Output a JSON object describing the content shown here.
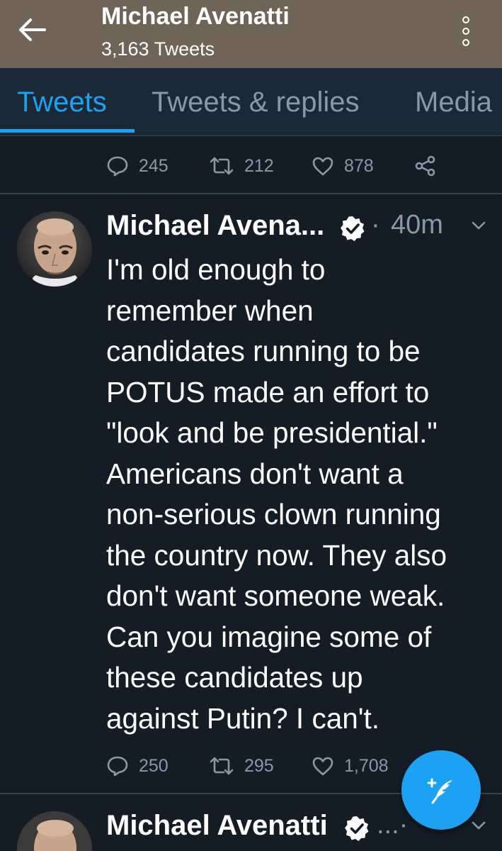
{
  "header": {
    "title": "Michael Avenatti",
    "subtitle": "3,163 Tweets",
    "back_icon": "arrow-left-icon",
    "more_icon": "more-vertical-icon"
  },
  "tabs": [
    {
      "label": "Tweets",
      "active": true
    },
    {
      "label": "Tweets & replies",
      "active": false
    },
    {
      "label": "Media",
      "active": false
    }
  ],
  "tweets": [
    {
      "actions": {
        "replies": "245",
        "retweets": "212",
        "likes": "878"
      }
    },
    {
      "author": "Michael Avena...",
      "verified": true,
      "time": "40m",
      "separator": "·",
      "text": "I'm old enough to\nremember when\ncandidates running to be\nPOTUS made an effort to\n\"look and be presidential.\"\nAmericans don't want a\nnon-serious clown running\nthe country now. They also\ndon't want someone weak.\nCan you imagine some of\nthese candidates up\nagainst Putin? I can't.",
      "actions": {
        "replies": "250",
        "retweets": "295",
        "likes": "1,708"
      }
    },
    {
      "author": "Michael Avenatti",
      "verified": true,
      "separator": "...·"
    }
  ],
  "colors": {
    "header_bg": "#6f6457",
    "tab_bar_bg": "#1b2836",
    "feed_bg": "#141d26",
    "accent": "#1da1f2",
    "muted": "#8899a6"
  },
  "fab": {
    "icon": "compose-tweet-icon"
  }
}
